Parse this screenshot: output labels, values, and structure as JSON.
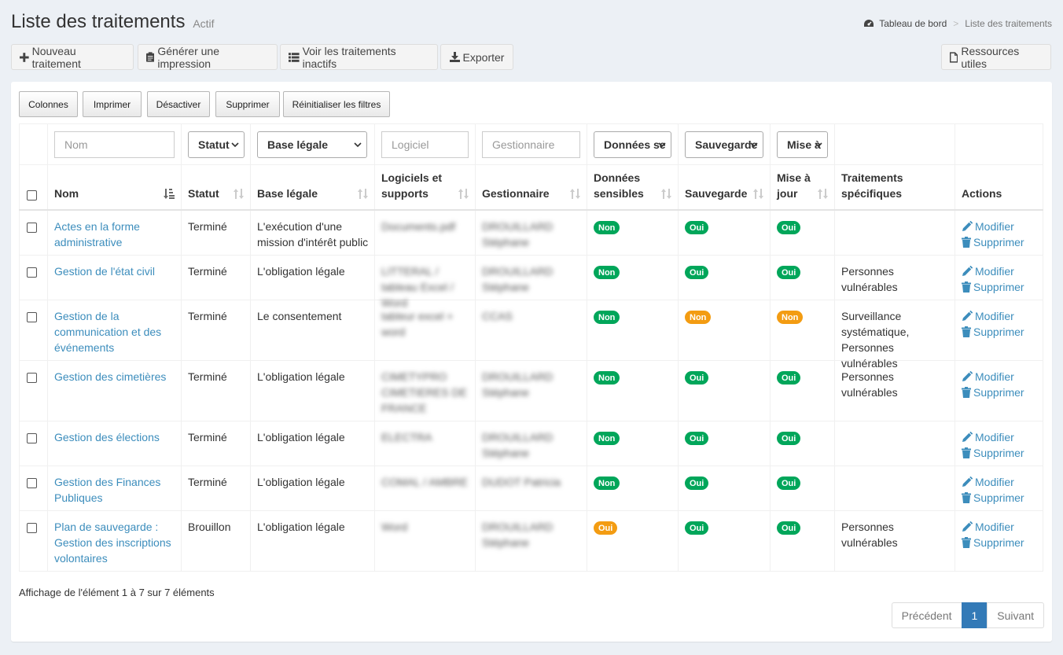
{
  "header": {
    "title": "Liste des traitements",
    "subtitle": "Actif",
    "breadcrumb": {
      "home": "Tableau de bord",
      "separator": ">",
      "current": "Liste des traitements"
    }
  },
  "toolbar": {
    "new": "Nouveau traitement",
    "print": "Générer une impression",
    "inactive": "Voir les traitements inactifs",
    "export": "Exporter",
    "resources": "Ressources utiles"
  },
  "dt_buttons": [
    "Colonnes",
    "Imprimer",
    "Désactiver",
    "Supprimer",
    "Réinitialiser les filtres"
  ],
  "filters": {
    "nom": "Nom",
    "statut": "Statut",
    "base": "Base légale",
    "logiciel": "Logiciel",
    "gestionnaire": "Gestionnaire",
    "donnees": "Données se",
    "sauvegarde": "Sauvegarde",
    "mise": "Mise à"
  },
  "columns": {
    "nom": "Nom",
    "statut": "Statut",
    "base": "Base légale",
    "logiciels": "Logiciels et supports",
    "gestionnaire": "Gestionnaire",
    "donnees": "Données sensibles",
    "sauvegarde": "Sauvegarde",
    "mise": "Mise à jour",
    "traitements": "Traitements spécifiques",
    "actions": "Actions"
  },
  "actions": {
    "edit": "Modifier",
    "delete": "Supprimer"
  },
  "rows": [
    {
      "nom": "Actes en la forme administrative",
      "statut": "Terminé",
      "base": "L'exécution d'une mission d'intérêt public",
      "logiciels": "Documents.pdf",
      "gestionnaire": "DROUILLARD Stéphane",
      "donnees": "Non",
      "sauvegarde": "Oui",
      "mise": "Oui",
      "traitements": ""
    },
    {
      "nom": "Gestion de l'état civil",
      "statut": "Terminé",
      "base": "L'obligation légale",
      "logiciels": "LITTERAL / tableau Excel / Word",
      "gestionnaire": "DROUILLARD Stéphane",
      "donnees": "Non",
      "sauvegarde": "Oui",
      "mise": "Oui",
      "traitements": "Personnes vulnérables"
    },
    {
      "nom": "Gestion de la communication et des événements",
      "statut": "Terminé",
      "base": "Le consentement",
      "logiciels": "tableur excel + word",
      "gestionnaire": "CCAS",
      "donnees": "Non",
      "sauvegarde": "Non",
      "mise": "Non",
      "traitements": "Surveillance systématique, Personnes vulnérables"
    },
    {
      "nom": "Gestion des cimetières",
      "statut": "Terminé",
      "base": "L'obligation légale",
      "logiciels": "CIMETYPRO CIMETIERES DE FRANCE",
      "gestionnaire": "DROUILLARD Stéphane",
      "donnees": "Non",
      "sauvegarde": "Oui",
      "mise": "Oui",
      "traitements": "Personnes vulnérables"
    },
    {
      "nom": "Gestion des élections",
      "statut": "Terminé",
      "base": "L'obligation légale",
      "logiciels": "ELECTRA",
      "gestionnaire": "DROUILLARD Stéphane",
      "donnees": "Non",
      "sauvegarde": "Oui",
      "mise": "Oui",
      "traitements": ""
    },
    {
      "nom": "Gestion des Finances Publiques",
      "statut": "Terminé",
      "base": "L'obligation légale",
      "logiciels": "COMAL / AMBRE",
      "gestionnaire": "DUDOT Patricia",
      "donnees": "Non",
      "sauvegarde": "Oui",
      "mise": "Oui",
      "traitements": ""
    },
    {
      "nom": "Plan de sauvegarde : Gestion des inscriptions volontaires",
      "statut": "Brouillon",
      "base": "L'obligation légale",
      "logiciels": "Word",
      "gestionnaire": "DROUILLARD Stéphane",
      "donnees": "Oui",
      "sauvegarde": "Oui",
      "mise": "Oui",
      "traitements": "Personnes vulnérables"
    }
  ],
  "info": "Affichage de l'élément 1 à 7 sur 7 éléments",
  "pagination": {
    "prev": "Précédent",
    "page": "1",
    "next": "Suivant"
  },
  "colors": {
    "link": "#3c8dbc",
    "green": "#00a65a",
    "orange": "#f39c12",
    "active_page": "#337ab7"
  }
}
